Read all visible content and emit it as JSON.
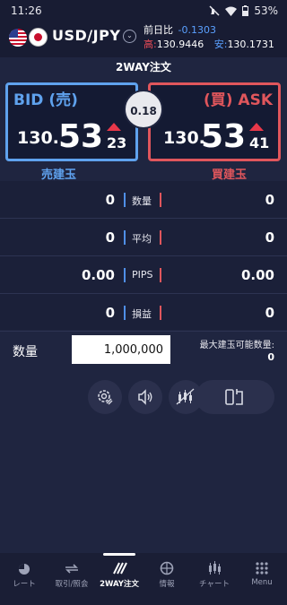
{
  "status_bar": {
    "time": "11:26",
    "battery": "53%"
  },
  "header": {
    "pair": "USD/JPY",
    "prev_label": "前日比",
    "prev_change": "-0.1303",
    "high_label": "高:",
    "high_value": "130.9446",
    "low_label": "安:",
    "low_value": "130.1731"
  },
  "order_title": "2WAY注文",
  "bid": {
    "label": "BID (売)",
    "price_int": "130.",
    "price_big": "53",
    "price_small": "23",
    "action": "売建玉"
  },
  "ask": {
    "label": "(買) ASK",
    "price_int": "130.",
    "price_big": "53",
    "price_small": "41",
    "action": "買建玉"
  },
  "spread": "0.18",
  "stats": [
    {
      "name": "数量",
      "sell": "0",
      "buy": "0"
    },
    {
      "name": "平均",
      "sell": "0",
      "buy": "0"
    },
    {
      "name": "PIPS",
      "sell": "0.00",
      "buy": "0.00"
    },
    {
      "name": "損益",
      "sell": "0",
      "buy": "0"
    }
  ],
  "quantity": {
    "label": "数量",
    "value": "1,000,000",
    "max_label": "最大建玉可能数量:",
    "max_value": "0"
  },
  "tools": [
    "settings-icon",
    "sound-icon",
    "chart-toggle-icon",
    "rotate-icon"
  ],
  "tabs": [
    {
      "label": "レート",
      "icon": "rate-icon"
    },
    {
      "label": "取引/照会",
      "icon": "trade-icon"
    },
    {
      "label": "2WAY注文",
      "icon": "twoway-icon",
      "active": true
    },
    {
      "label": "情報",
      "icon": "info-icon"
    },
    {
      "label": "チャート",
      "icon": "chart-icon"
    },
    {
      "label": "Menu",
      "icon": "menu-icon"
    }
  ],
  "colors": {
    "background": "#1f2540",
    "bid": "#5fa2ee",
    "ask": "#e0565c",
    "up_arrow": "#e8384a"
  }
}
